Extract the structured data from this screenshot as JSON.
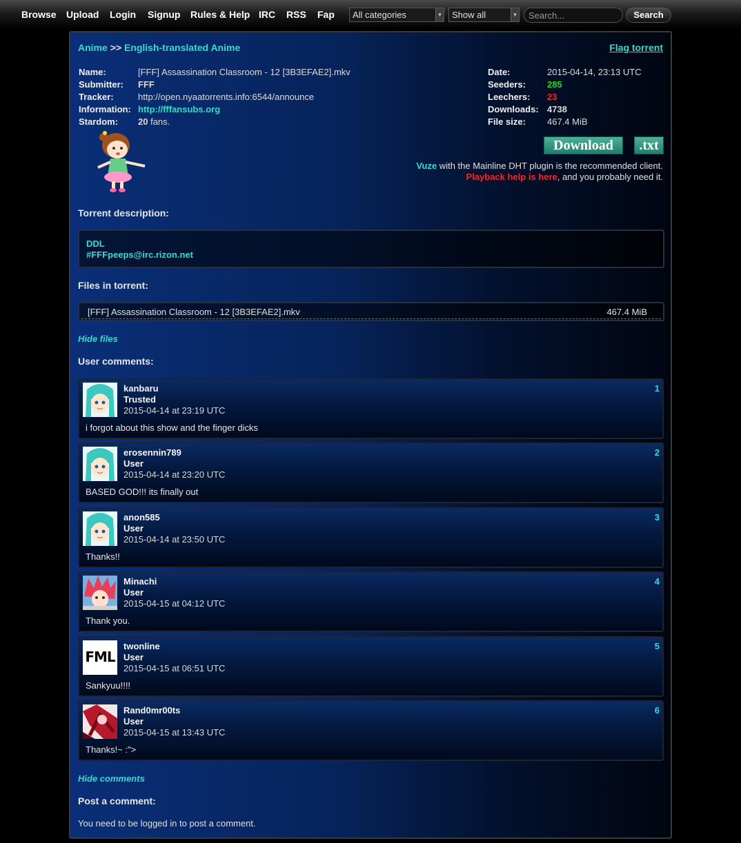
{
  "nav": {
    "links": [
      "Browse",
      "Upload",
      "Login",
      "Signup",
      "Rules & Help",
      "IRC",
      "RSS",
      "Fap"
    ],
    "category_select": "All categories",
    "filter_select": "Show all",
    "search_placeholder": "Search...",
    "search_button": "Search"
  },
  "breadcrumb": {
    "category": "Anime",
    "separator": ">>",
    "subcategory": "English-translated Anime"
  },
  "flag_link": "Flag torrent",
  "details_left": [
    {
      "label": "Name:",
      "value": "[FFF] Assassination Classroom - 12 [3B3EFAE2].mkv"
    },
    {
      "label": "Submitter:",
      "value": "FFF"
    },
    {
      "label": "Tracker:",
      "value": "http://open.nyaatorrents.info:6544/announce"
    },
    {
      "label": "Information:",
      "value": "http://fffansubs.org"
    },
    {
      "label": "Stardom:",
      "value_bold": "20",
      "value": " fans."
    }
  ],
  "details_right": [
    {
      "label": "Date:",
      "value": "2015-04-14, 23:13 UTC"
    },
    {
      "label": "Seeders:",
      "value": "285"
    },
    {
      "label": "Leechers:",
      "value": "23"
    },
    {
      "label": "Downloads:",
      "value": "4738"
    },
    {
      "label": "File size:",
      "value": "467.4 MiB"
    }
  ],
  "colors": {
    "seeders": "#22dd22",
    "leechers": "#ff2222",
    "accent": "#33ddcc",
    "playback": "#ff2222"
  },
  "download_button": "Download",
  "txt_button": ".txt",
  "client_note": {
    "client": "Vuze",
    "rest": " with the Mainline DHT plugin is the recommended client."
  },
  "playback_note": {
    "link": "Playback help is here",
    "rest": ", and you probably need it."
  },
  "description_heading": "Torrent description:",
  "description_lines": [
    "DDL",
    "#FFFpeeps@irc.rizon.net"
  ],
  "files_heading": "Files in torrent:",
  "files": [
    {
      "name": "[FFF] Assassination Classroom - 12 [3B3EFAE2].mkv",
      "size": "467.4 MiB"
    }
  ],
  "hide_files": "Hide files",
  "comments_heading": "User comments:",
  "comments": [
    {
      "user": "kanbaru",
      "role": "Trusted",
      "date": "2015-04-14 at 23:19 UTC",
      "text": "i forgot about this show and the finger dicks",
      "num": "1",
      "avatar": "miku"
    },
    {
      "user": "erosennin789",
      "role": "User",
      "date": "2015-04-14 at 23:20 UTC",
      "text": "BASED GOD!!! its finally out",
      "num": "2",
      "avatar": "miku"
    },
    {
      "user": "anon585",
      "role": "User",
      "date": "2015-04-14 at 23:50 UTC",
      "text": "Thanks!!",
      "num": "3",
      "avatar": "miku"
    },
    {
      "user": "Minachi",
      "role": "User",
      "date": "2015-04-15 at 04:12 UTC",
      "text": "Thank you.",
      "num": "4",
      "avatar": "redhair"
    },
    {
      "user": "twonline",
      "role": "User",
      "date": "2015-04-15 at 06:51 UTC",
      "text": "Sankyuu!!!!",
      "num": "5",
      "avatar": "fml"
    },
    {
      "user": "Rand0mr00ts",
      "role": "User",
      "date": "2015-04-15 at 13:43 UTC",
      "text": "Thanks!~ :\">",
      "num": "6",
      "avatar": "redart"
    }
  ],
  "hide_comments": "Hide comments",
  "post_heading": "Post a comment:",
  "login_note": "You need to be logged in to post a comment.",
  "fml_logo_text": "FML"
}
